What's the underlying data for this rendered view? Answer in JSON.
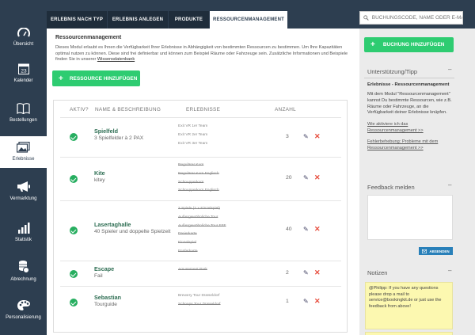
{
  "sidebar": {
    "items": [
      {
        "label": "Übersicht",
        "icon": "speedometer-icon"
      },
      {
        "label": "Kalender",
        "icon": "calendar-icon",
        "calendar_day": "23"
      },
      {
        "label": "Bestellungen",
        "icon": "book-icon"
      },
      {
        "label": "Erlebnisse",
        "icon": "photos-icon"
      },
      {
        "label": "Vermarktung",
        "icon": "megaphone-icon"
      },
      {
        "label": "Statistik",
        "icon": "bar-chart-icon"
      },
      {
        "label": "Abrechnung",
        "icon": "coins-icon"
      },
      {
        "label": "Personalisierung",
        "icon": "palette-icon"
      }
    ]
  },
  "tabs": [
    "ERLEBNIS NACH TYP",
    "ERLEBNIS ANLEGEN",
    "PRODUKTE",
    "RESSOURCENMANAGEMENT"
  ],
  "search": {
    "placeholder": "BUCHUNGSCODE, NAME ODER E-MAIL"
  },
  "main": {
    "title": "Ressourcenmanagement",
    "description": "Dieses Modul erlaubt es Ihnen die Verfügbarkeit Ihrer Erlebnisse in Abhängigkeit von bestimmten Ressourcen zu bestimmen. Um Ihre Kapazitäten optimal nutzen zu können. Diese sind frei definierbar und können zum Beispiel Räume oder Fahrzeuge sein. Zusätzliche Informationen und Beispiele finden Sie in unserer",
    "description_link": "Wissensdatenbank",
    "add_button": "RESSOURCE HINZUFÜGEN",
    "table": {
      "headers": [
        "AKTIV?",
        "NAME & BESCHREIBUNG",
        "ERLEBNISSE",
        "ANZAHL"
      ],
      "rows": [
        {
          "name": "Spielfeld",
          "desc": "3 Spielfelder à 2 PAX",
          "qty": "3",
          "events": [
            {
              "t": "Exit VR 1er Team",
              "s": false
            },
            {
              "t": "Exit VR 2er Team",
              "s": false
            },
            {
              "t": "Exit VR 3er Team",
              "s": false
            }
          ]
        },
        {
          "name": "Kite",
          "desc": "kitey",
          "qty": "20",
          "events": [
            {
              "t": "Regulärer Kurs",
              "s": true
            },
            {
              "t": "Regulärer Kurs Englisch",
              "s": true
            },
            {
              "t": "Schnupperkurs",
              "s": true
            },
            {
              "t": "Schnupperkurs Englisch",
              "s": true
            }
          ]
        },
        {
          "name": "Lasertaghalle",
          "desc": "40 Spieler und doppelte Spielzeit",
          "qty": "40",
          "events": [
            {
              "t": "2 Spiele (2 × Einzelspiel)",
              "s": true
            },
            {
              "t": "Außergewöhnliche Tour",
              "s": true
            },
            {
              "t": "Außergewöhnliche Tour FFF",
              "s": true
            },
            {
              "t": "Dreierkarte",
              "s": true
            },
            {
              "t": "Einzelspiel",
              "s": true
            },
            {
              "t": "Fünferkarte",
              "s": true
            }
          ]
        },
        {
          "name": "Escape",
          "desc": "Fail",
          "qty": "2",
          "events": [
            {
              "t": "Amusement Park",
              "s": true
            }
          ]
        },
        {
          "name": "Sebastian",
          "desc": "Tourguide",
          "qty": "1",
          "events": [
            {
              "t": "Brewery Tour Düsseldorf",
              "s": false
            },
            {
              "t": "Schnaps Tour Düsseldorf",
              "s": true
            }
          ]
        }
      ]
    }
  },
  "right": {
    "book_button": "BUCHUNG HINZUFÜGEN",
    "tip_title": "Unterstützung/Tipp",
    "tip_subtitle": "Erlebnisse - Ressourcenmanagement",
    "tip_text": "Mit dem Modul \"Ressourcenmanagement\" kannst Du bestimmte Ressourcen, wie z.B. Räume oder Fahrzeuge, an die Verfügbarkeit deiner Erlebnisse knüpfen.",
    "tip_link1": "Wie aktiviere ich das Ressourcenmanagement >>",
    "tip_link2": "Fehlerbehebung: Probleme mit dem Ressourcenmanagement >>",
    "feedback_title": "Feedback melden",
    "send_button": "ABSENDEN",
    "notes_title": "Notizen",
    "note_text": "@Philipp: If you have any questions please drop a mail to service@bookingkit.de or just use the feedback from above!"
  },
  "colors": {
    "sidebar": "#2d3e50",
    "accent_green": "#2ecc71",
    "check_green": "#27ae60",
    "delete_red": "#e74c3c",
    "send_blue": "#2980b9",
    "note_yellow": "#fcf8b0"
  }
}
